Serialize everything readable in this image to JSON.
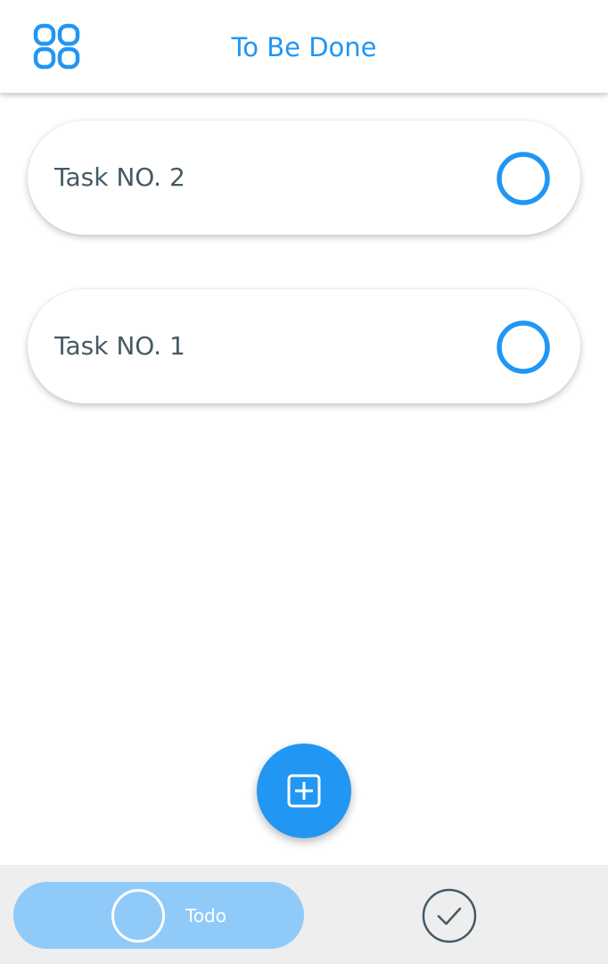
{
  "app_bar": {
    "title": "To Be Done",
    "menu_icon": "grid-icon"
  },
  "tasks": [
    {
      "title": "Task NO. 2",
      "completed": false,
      "icon": "circle-outline-icon"
    },
    {
      "title": "Task NO. 1",
      "completed": false,
      "icon": "circle-outline-icon"
    }
  ],
  "fab": {
    "icon": "add-box-icon"
  },
  "bottom_nav": {
    "tabs": [
      {
        "label": "Todo",
        "icon": "circle-outline-icon",
        "active": true
      },
      {
        "label": "",
        "icon": "check-circle-icon",
        "active": false
      }
    ]
  },
  "colors": {
    "accent": "#2196F3",
    "active_tab_bg": "#90CAF9",
    "task_text": "#455A64",
    "bottom_bar_bg": "#EEEEEE"
  }
}
